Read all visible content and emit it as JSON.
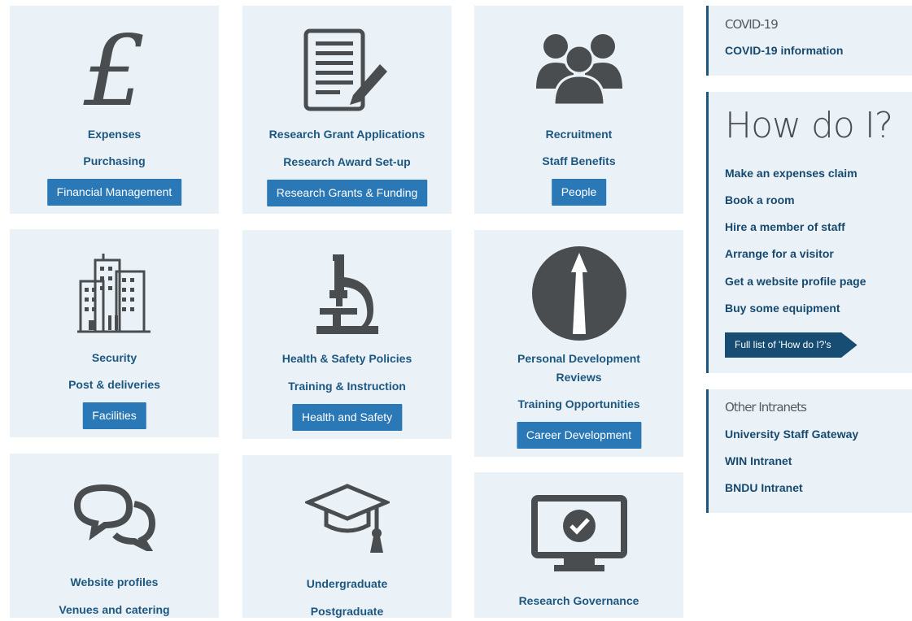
{
  "cards": {
    "finance": {
      "link1": "Expenses",
      "link2": "Purchasing",
      "button": "Financial Management",
      "icon": "pound-icon"
    },
    "research": {
      "link1": "Research Grant Applications",
      "link2": "Research Award Set-up",
      "button": "Research Grants & Funding",
      "icon": "document-pencil-icon"
    },
    "people": {
      "link1": "Recruitment",
      "link2": "Staff Benefits",
      "button": "People",
      "icon": "people-icon"
    },
    "facilities": {
      "link1": "Security",
      "link2": "Post & deliveries",
      "button": "Facilities",
      "icon": "building-icon"
    },
    "health": {
      "link1": "Health & Safety Policies",
      "link2": "Training & Instruction",
      "button": "Health and Safety",
      "icon": "microscope-icon"
    },
    "career": {
      "link1a": "Personal Development",
      "link1b": "Reviews",
      "link2": "Training Opportunities",
      "button": "Career Development",
      "icon": "arrow-up-circle-icon"
    },
    "comms": {
      "link1": "Website profiles",
      "link2": "Venues and catering",
      "icon": "speech-bubbles-icon"
    },
    "education": {
      "link1": "Undergraduate",
      "link2": "Postgraduate",
      "icon": "graduation-cap-icon"
    },
    "governance": {
      "link1": "Research Governance",
      "icon": "monitor-check-icon"
    }
  },
  "sidebar": {
    "covid": {
      "title": "COVID-19",
      "link": "COVID-19 information"
    },
    "howdoi": {
      "title": "How do I?",
      "links": [
        "Make an expenses claim",
        "Book a room",
        "Hire a member of staff",
        "Arrange for a visitor",
        "Get a website profile page",
        "Buy some equipment"
      ],
      "button": "Full list of 'How do I?'s"
    },
    "other": {
      "title": "Other Intranets",
      "links": [
        "University Staff Gateway",
        "WIN Intranet",
        "BNDU Intranet"
      ]
    }
  },
  "colors": {
    "card_bg": "#eaf2f8",
    "link": "#1d5780",
    "button": "#2a78b5",
    "icon": "#4a4d50",
    "accent": "#174d73"
  }
}
